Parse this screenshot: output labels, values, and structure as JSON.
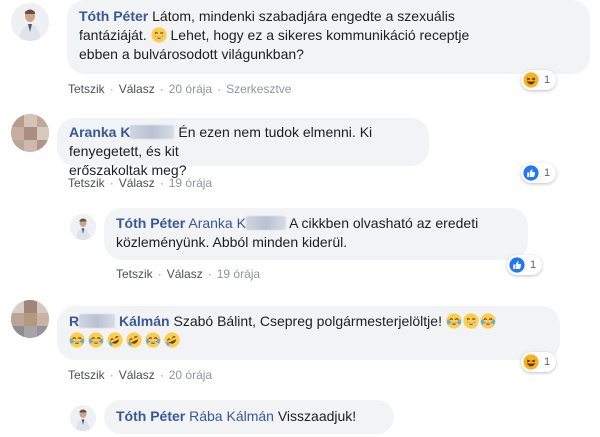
{
  "comments": [
    {
      "author": "Tóth Péter",
      "text_line1": "Látom, mindenki szabadjára engedte a szexuális",
      "text_line2_a": "fantáziáját.",
      "text_line2_b": "Lehet, hogy ez a sikeres kommunikáció receptje",
      "text_line3": "ebben a bulvárosodott világunkban?",
      "like": "Tetszik",
      "reply": "Válasz",
      "time": "20 órája",
      "edited": "Szerkesztve",
      "reaction_type": "haha-icon",
      "reaction_count": "1"
    },
    {
      "author_first": "Aranka K",
      "text_line1": "Én ezen nem tudok elmenni. Ki fenyegetett, és kit",
      "text_line2": "erőszakoltak meg?",
      "like": "Tetszik",
      "reply": "Válasz",
      "time": "19 órája",
      "reaction_type": "like-icon",
      "reaction_count": "1"
    },
    {
      "author": "Tóth Péter",
      "mention": "Aranka K",
      "text_line1": "A cikkben olvasható az eredeti",
      "text_line2": "közleményünk. Abból minden kiderül.",
      "like": "Tetszik",
      "reply": "Válasz",
      "time": "19 órája",
      "reaction_type": "like-icon",
      "reaction_count": "1"
    },
    {
      "author_first": "R",
      "author_last": "Kálmán",
      "text_line1": "Szabó Bálint, Csepreg polgármesterjelöltje!",
      "like": "Tetszik",
      "reply": "Válasz",
      "time": "20 órája",
      "reaction_type": "haha-icon",
      "reaction_count": "1"
    },
    {
      "author": "Tóth Péter",
      "mention": "Rába Kálmán",
      "text_line1": "Visszaadjuk!"
    }
  ],
  "colors": {
    "author": "#385898",
    "bubble": "#f2f3f5",
    "meta": "#90949c",
    "like_blue": "#2078f4",
    "haha_yellow": "#f7b125"
  }
}
